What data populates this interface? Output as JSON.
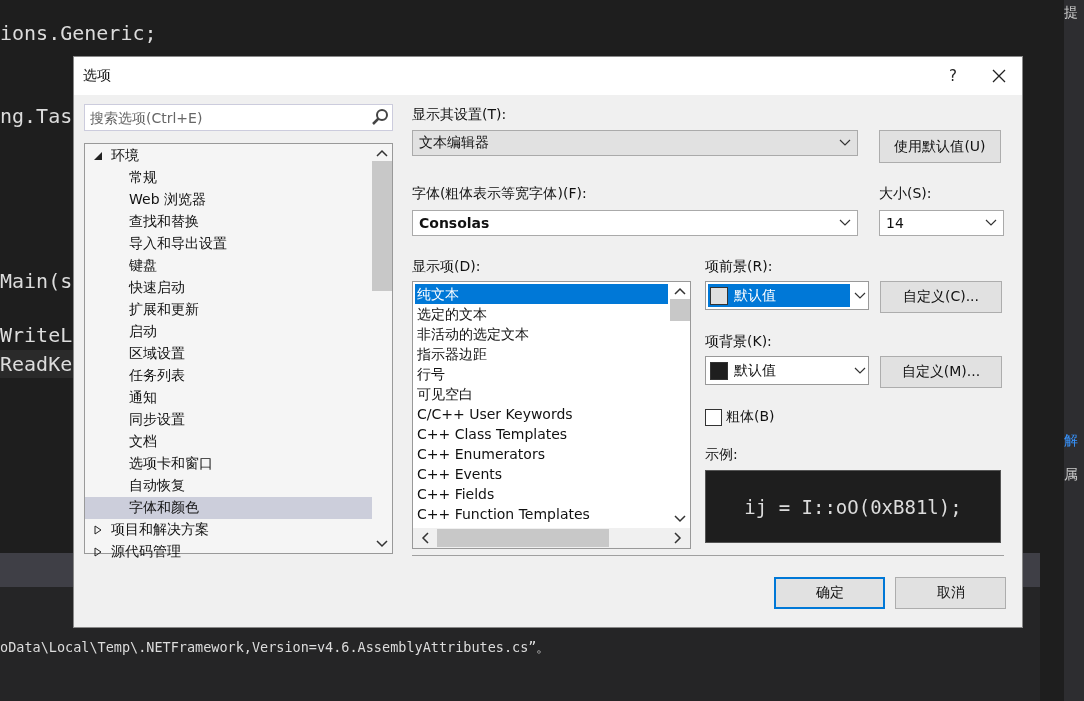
{
  "editor": {
    "code_lines": [
      "ions.Generic;",
      "ng.Tas",
      "Main(s",
      "WriteL",
      "ReadKe"
    ],
    "output_line": "oData\\Local\\Temp\\.NETFramework,Version=v4.6.AssemblyAttributes.cs”。",
    "side_labels": [
      "提",
      "解",
      "属"
    ]
  },
  "dialog": {
    "title": "选项",
    "help": "?",
    "search": {
      "placeholder": "搜索选项(Ctrl+E)"
    },
    "tree": [
      {
        "label": "环境",
        "expanded": true,
        "selected": false,
        "children": [
          {
            "label": "常规",
            "selected": false
          },
          {
            "label": "Web 浏览器",
            "selected": false
          },
          {
            "label": "查找和替换",
            "selected": false
          },
          {
            "label": "导入和导出设置",
            "selected": false
          },
          {
            "label": "键盘",
            "selected": false
          },
          {
            "label": "快速启动",
            "selected": false
          },
          {
            "label": "扩展和更新",
            "selected": false
          },
          {
            "label": "启动",
            "selected": false
          },
          {
            "label": "区域设置",
            "selected": false
          },
          {
            "label": "任务列表",
            "selected": false
          },
          {
            "label": "通知",
            "selected": false
          },
          {
            "label": "同步设置",
            "selected": false
          },
          {
            "label": "文档",
            "selected": false
          },
          {
            "label": "选项卡和窗口",
            "selected": false
          },
          {
            "label": "自动恢复",
            "selected": false
          },
          {
            "label": "字体和颜色",
            "selected": true
          }
        ]
      },
      {
        "label": "项目和解决方案",
        "expanded": false,
        "selected": false
      },
      {
        "label": "源代码管理",
        "expanded": false,
        "selected": false
      }
    ],
    "show_settings_for": {
      "label": "显示其设置(T):",
      "value": "文本编辑器"
    },
    "use_defaults_button": "使用默认值(U)",
    "font": {
      "label": "字体(粗体表示等宽字体)(F):",
      "value": "Consolas"
    },
    "size": {
      "label": "大小(S):",
      "value": "14"
    },
    "display_items": {
      "label": "显示项(D):",
      "items": [
        {
          "label": "纯文本",
          "selected": true
        },
        {
          "label": "选定的文本",
          "selected": false
        },
        {
          "label": "非活动的选定文本",
          "selected": false
        },
        {
          "label": "指示器边距",
          "selected": false
        },
        {
          "label": "行号",
          "selected": false
        },
        {
          "label": "可见空白",
          "selected": false
        },
        {
          "label": "C/C++ User Keywords",
          "selected": false
        },
        {
          "label": "C++ Class Templates",
          "selected": false
        },
        {
          "label": "C++ Enumerators",
          "selected": false
        },
        {
          "label": "C++ Events",
          "selected": false
        },
        {
          "label": "C++ Fields",
          "selected": false
        },
        {
          "label": "C++ Function Templates",
          "selected": false
        }
      ]
    },
    "item_foreground": {
      "label": "项前景(R):",
      "value": "默认值",
      "color": "#e0e0e0",
      "focused": true,
      "button": "自定义(C)..."
    },
    "item_background": {
      "label": "项背景(K):",
      "value": "默认值",
      "color": "#1e1e1e",
      "focused": false,
      "button": "自定义(M)..."
    },
    "bold": {
      "label": "粗体(B)",
      "checked": false
    },
    "sample": {
      "label": "示例:",
      "text": "ij = I::oO(0xB81l);"
    },
    "buttons": [
      {
        "label": "确定",
        "default": true
      },
      {
        "label": "取消",
        "default": false
      }
    ]
  }
}
